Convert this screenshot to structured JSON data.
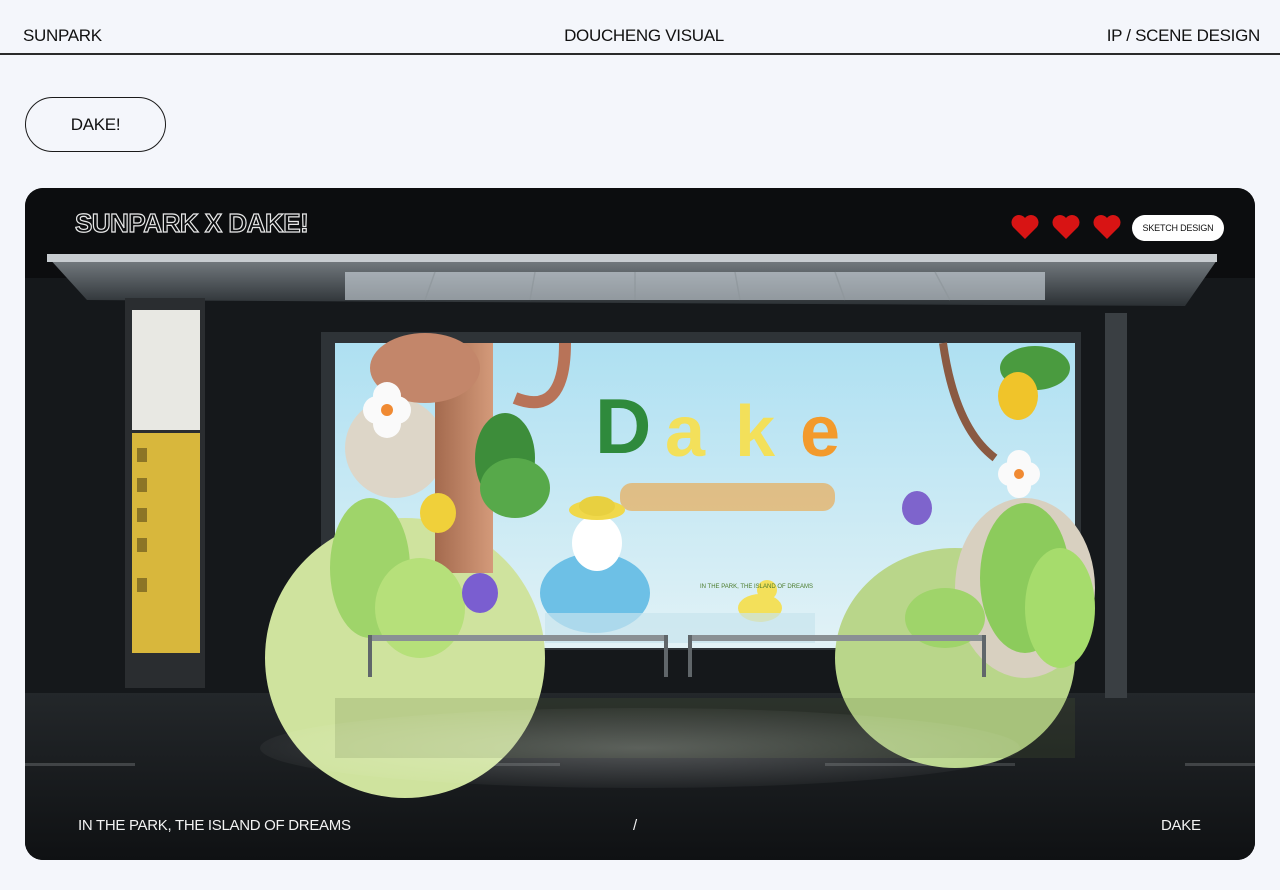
{
  "header": {
    "brand": "SUNPARK",
    "studio": "DOUCHENG VISUAL",
    "category": "IP / SCENE DESIGN"
  },
  "project_button": {
    "label": "DAKE!"
  },
  "showcase": {
    "title": "SUNPARK X DAKE!",
    "hearts_count": 3,
    "heart_color": "#d81414",
    "tag_button": "SKETCH DESIGN",
    "poster": {
      "logo_letters": [
        "D",
        "a",
        "k",
        "e"
      ],
      "tagline": "IN THE PARK, THE ISLAND OF DREAMS"
    },
    "footer": {
      "left": "IN THE PARK, THE ISLAND OF DREAMS",
      "divider": "/",
      "right": "DAKE"
    }
  },
  "colors": {
    "page_bg": "#f4f6fb",
    "card_bg": "#0c0d0f",
    "sky": "#bfe0ef",
    "leaf_green": "#9fd46a",
    "logo_green": "#2f8a3c",
    "logo_yellow": "#f3e05a",
    "logo_orange": "#f39a2c"
  }
}
